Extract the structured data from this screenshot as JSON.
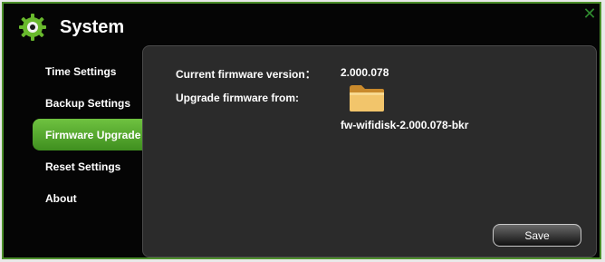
{
  "app": {
    "title": "System",
    "close_icon": "close-icon"
  },
  "sidebar": {
    "items": [
      {
        "label": "Time Settings"
      },
      {
        "label": "Backup Settings"
      },
      {
        "label": "Firmware Upgrade",
        "active": true
      },
      {
        "label": "Reset Settings"
      },
      {
        "label": "About"
      }
    ]
  },
  "firmware": {
    "current_label": "Current firmware version：",
    "current_value": "2.000.078",
    "upgrade_label": "Upgrade firmware from:",
    "file_name": "fw-wifidisk-2.000.078-bkr",
    "folder_icon": "folder-icon"
  },
  "actions": {
    "save_label": "Save"
  },
  "colors": {
    "accent": "#4c8f2b",
    "active_tab": "#5aa632",
    "panel": "#2b2b2b"
  }
}
